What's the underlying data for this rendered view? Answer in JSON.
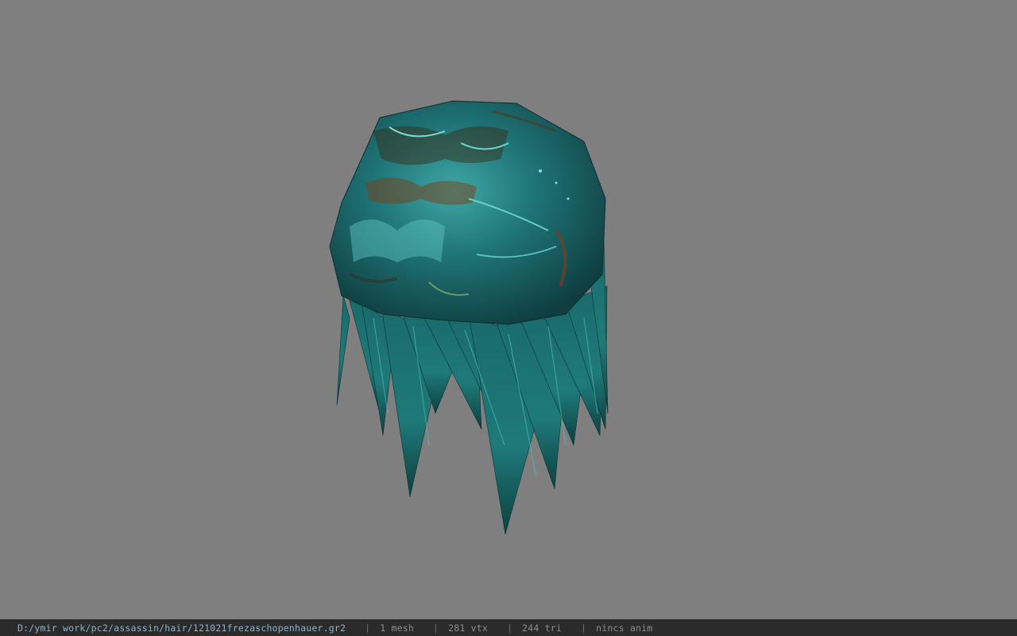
{
  "viewport": {
    "background": "#7f7f7f",
    "model_icon": "hair-mesh"
  },
  "statusbar": {
    "file_path": "D:/ymir work/pc2/assassin/hair/121021frezaschopenhauer.gr2",
    "separator": "|",
    "mesh_count": "1 mesh",
    "vertex_count": "281 vtx",
    "triangle_count": "244 tri",
    "anim_status": "nincs anim"
  },
  "colors": {
    "mesh_base": "#1f6f72",
    "mesh_highlight": "#5fd6d2",
    "mesh_rust": "#8a4a1c",
    "statusbar_bg": "#2b2b2b",
    "path_text": "#8fb3cc",
    "info_text": "#8c8c8c"
  }
}
